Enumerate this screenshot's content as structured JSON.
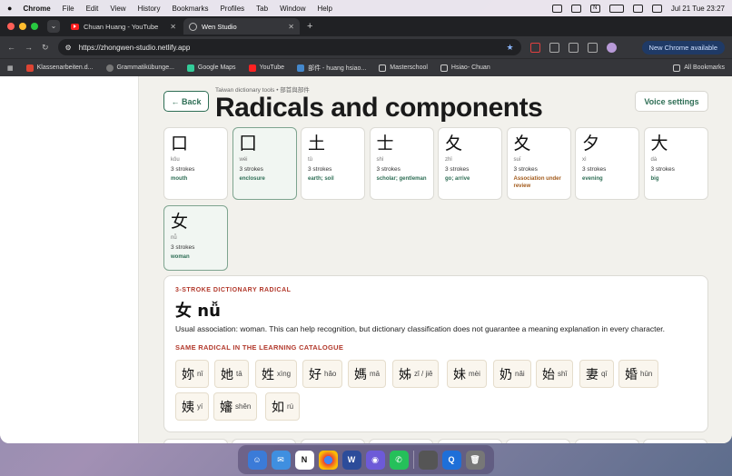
{
  "menubar": {
    "app": "Chrome",
    "items": [
      "File",
      "Edit",
      "View",
      "History",
      "Bookmarks",
      "Profiles",
      "Tab",
      "Window",
      "Help"
    ],
    "datetime": "Jul 21 Tue  23:27"
  },
  "tabs": [
    {
      "label": "Chuan Huang - YouTube"
    },
    {
      "label": "Wen Studio"
    }
  ],
  "omnibox": {
    "url": "https://zhongwen-studio.netlify.app"
  },
  "new_chrome": "New Chrome available",
  "bookmarks": [
    "Klassenarbeiten.d...",
    "Grammatikübunge...",
    "Google Maps",
    "YouTube",
    "部件 - huang hsiao...",
    "Masterschool",
    "Hsiao- Chuan"
  ],
  "all_bookmarks": "All Bookmarks",
  "page": {
    "back": "← Back",
    "crumb": "Taiwan dictionary tools • 部首與部件",
    "title": "Radicals and components",
    "voice": "Voice settings",
    "cards": [
      {
        "char": "口",
        "pinyin": "kǒu",
        "strokes": "3 strokes",
        "meaning": "mouth"
      },
      {
        "char": "囗",
        "pinyin": "wéi",
        "strokes": "3 strokes",
        "meaning": "enclosure"
      },
      {
        "char": "土",
        "pinyin": "tǔ",
        "strokes": "3 strokes",
        "meaning": "earth; soil"
      },
      {
        "char": "士",
        "pinyin": "shì",
        "strokes": "3 strokes",
        "meaning": "scholar; gentleman"
      },
      {
        "char": "夂",
        "pinyin": "zhǐ",
        "strokes": "3 strokes",
        "meaning": "go; arrive"
      },
      {
        "char": "夊",
        "pinyin": "suī",
        "strokes": "3 strokes",
        "meaning": "Association under review"
      },
      {
        "char": "夕",
        "pinyin": "xì",
        "strokes": "3 strokes",
        "meaning": "evening"
      },
      {
        "char": "大",
        "pinyin": "dà",
        "strokes": "3 strokes",
        "meaning": "big"
      },
      {
        "char": "女",
        "pinyin": "nǚ",
        "strokes": "3 strokes",
        "meaning": "woman"
      }
    ],
    "detail": {
      "label": "3-STROKE DICTIONARY RADICAL",
      "heading": "女 nǚ",
      "text": "Usual association: woman. This can help recognition, but dictionary classification does not guarantee a meaning explanation in every character.",
      "sub": "SAME RADICAL IN THE LEARNING CATALOGUE",
      "chars": [
        {
          "c": "妳",
          "p": "nǐ"
        },
        {
          "c": "她",
          "p": "tā"
        },
        {
          "c": "姓",
          "p": "xìng"
        },
        {
          "c": "好",
          "p": "hǎo"
        },
        {
          "c": "媽",
          "p": "mā"
        },
        {
          "c": "姊",
          "p": "zǐ / jiě"
        },
        {
          "c": "妹",
          "p": "mèi"
        },
        {
          "c": "奶",
          "p": "nǎi"
        },
        {
          "c": "始",
          "p": "shǐ"
        },
        {
          "c": "妻",
          "p": "qī"
        },
        {
          "c": "婚",
          "p": "hūn"
        },
        {
          "c": "姨",
          "p": "yí"
        },
        {
          "c": "嬸",
          "p": "shěn"
        },
        {
          "c": "如",
          "p": "rú"
        }
      ]
    }
  },
  "colors": {
    "accent": "#2e6e55",
    "label_red": "#b2392c",
    "warn": "#a25a1b"
  }
}
